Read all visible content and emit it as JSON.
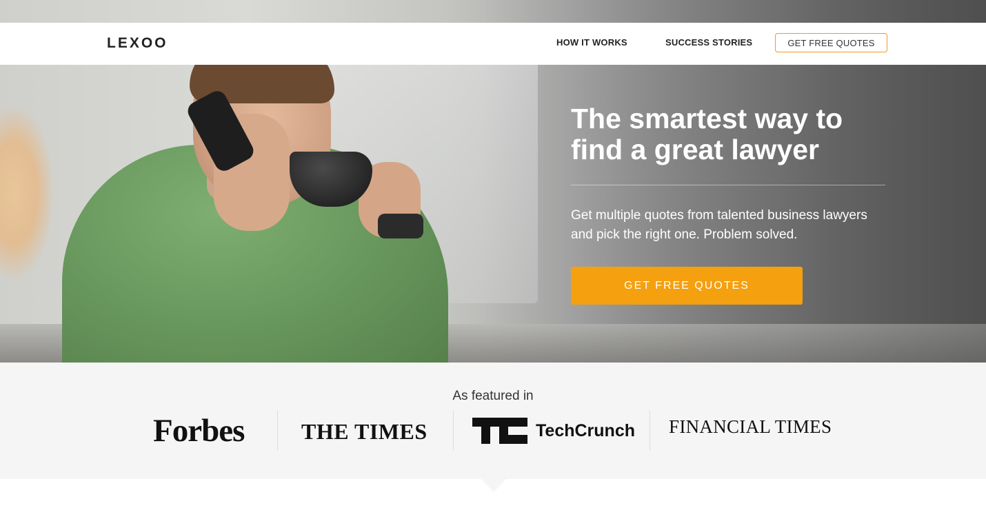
{
  "nav": {
    "logo": "LEXOO",
    "links": [
      "HOW IT WORKS",
      "SUCCESS STORIES"
    ],
    "cta_label": "GET FREE QUOTES"
  },
  "hero": {
    "title_line1": "The smartest way to",
    "title_line2": "find a great lawyer",
    "subtitle_line1": "Get multiple quotes from talented business lawyers",
    "subtitle_line2": "and pick the right one. Problem solved.",
    "cta_label": "GET FREE QUOTES"
  },
  "featured": {
    "label": "As featured in",
    "logos": [
      "Forbes",
      "THE TIMES",
      "TechCrunch",
      "FINANCIAL TIMES"
    ]
  },
  "colors": {
    "accent": "#f5a00e",
    "nav_cta_border": "#f39b16",
    "featured_bg": "#f5f5f5"
  }
}
